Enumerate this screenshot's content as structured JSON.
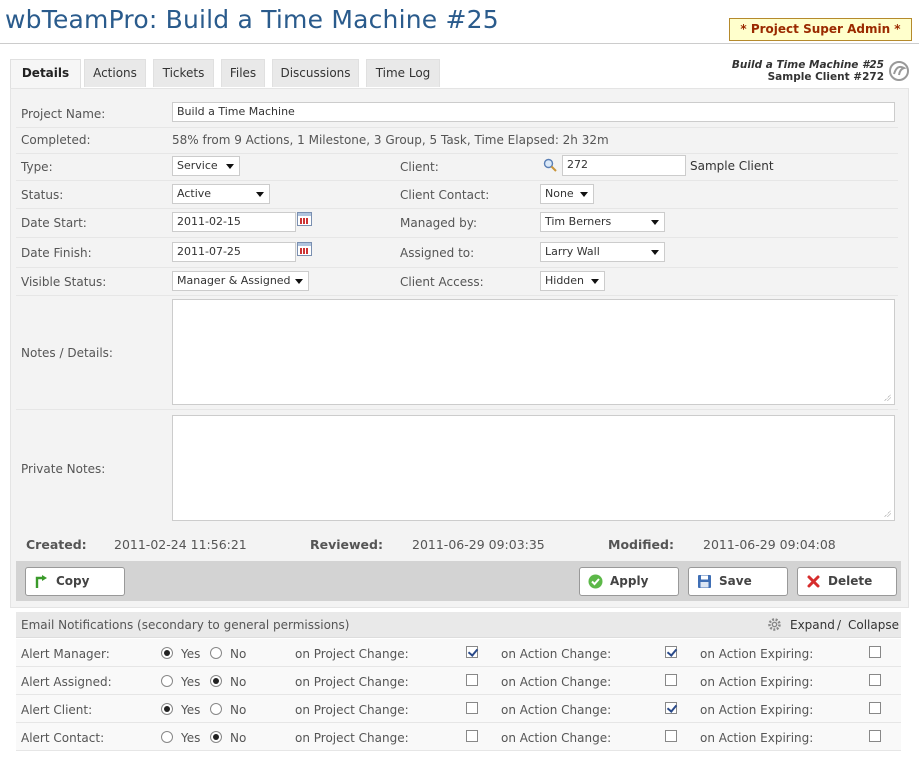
{
  "header": {
    "title": "wbTeamPro: Build a Time Machine #25",
    "badge": "* Project Super Admin *",
    "project_meta_line1": "Build a Time Machine #25",
    "project_meta_line2": "Sample Client #272"
  },
  "tabs": [
    {
      "label": "Details",
      "active": true
    },
    {
      "label": "Actions",
      "active": false
    },
    {
      "label": "Tickets",
      "active": false
    },
    {
      "label": "Files",
      "active": false
    },
    {
      "label": "Discussions",
      "active": false
    },
    {
      "label": "Time Log",
      "active": false
    }
  ],
  "form": {
    "project_name_label": "Project Name:",
    "project_name_value": "Build a Time Machine",
    "completed_label": "Completed:",
    "completed_value": "58% from 9 Actions, 1 Milestone, 3 Group, 5 Task, Time Elapsed: 2h 32m",
    "type_label": "Type:",
    "type_value": "Service",
    "client_label": "Client:",
    "client_value": "272",
    "client_name": "Sample Client",
    "status_label": "Status:",
    "status_value": "Active",
    "client_contact_label": "Client Contact:",
    "client_contact_value": "None",
    "date_start_label": "Date Start:",
    "date_start_value": "2011-02-15",
    "managed_by_label": "Managed by:",
    "managed_by_value": "Tim Berners",
    "date_finish_label": "Date Finish:",
    "date_finish_value": "2011-07-25",
    "assigned_to_label": "Assigned to:",
    "assigned_to_value": "Larry Wall",
    "visible_status_label": "Visible Status:",
    "visible_status_value": "Manager & Assigned",
    "client_access_label": "Client Access:",
    "client_access_value": "Hidden",
    "notes_label": "Notes / Details:",
    "notes_value": "",
    "private_notes_label": "Private Notes:",
    "private_notes_value": ""
  },
  "dates": {
    "created_label": "Created:",
    "created_value": "2011-02-24 11:56:21",
    "reviewed_label": "Reviewed:",
    "reviewed_value": "2011-06-29 09:03:35",
    "modified_label": "Modified:",
    "modified_value": "2011-06-29 09:04:08"
  },
  "buttons": {
    "copy": "Copy",
    "apply": "Apply",
    "save": "Save",
    "delete": "Delete"
  },
  "email": {
    "header": "Email Notifications (secondary to general permissions)",
    "expand": "Expand",
    "sep": "/",
    "collapse": "Collapse",
    "yes": "Yes",
    "no": "No",
    "on_project_change": "on Project Change:",
    "on_action_change": "on Action Change:",
    "on_action_expiring": "on Action Expiring:",
    "rows": [
      {
        "label": "Alert Manager:",
        "yes": true,
        "project_change": true,
        "action_change": true,
        "action_expiring": false
      },
      {
        "label": "Alert Assigned:",
        "yes": false,
        "project_change": false,
        "action_change": false,
        "action_expiring": false
      },
      {
        "label": "Alert Client:",
        "yes": true,
        "project_change": false,
        "action_change": true,
        "action_expiring": false
      },
      {
        "label": "Alert Contact:",
        "yes": false,
        "project_change": false,
        "action_change": false,
        "action_expiring": false
      }
    ]
  },
  "colors": {
    "title": "#2a5b8c",
    "badge_bg": "#ffffcc",
    "badge_text": "#9a2a00",
    "panel_bg": "#f3f3f3",
    "button_bar": "#d3d3d3"
  }
}
